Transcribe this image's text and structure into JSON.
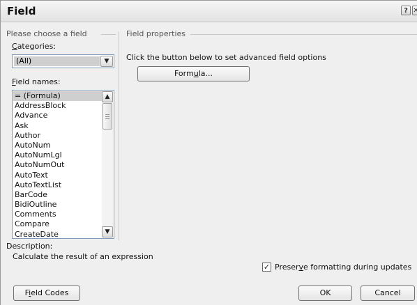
{
  "window": {
    "title": "Field",
    "help_label": "?",
    "close_label": "✕"
  },
  "left_group": {
    "heading": "Please choose a field",
    "categories_label_accel": "C",
    "categories_label_rest": "ategories:",
    "categories_value": "(All)",
    "field_names_label_accel": "F",
    "field_names_label_rest": "ield names:",
    "field_names": [
      "= (Formula)",
      "AddressBlock",
      "Advance",
      "Ask",
      "Author",
      "AutoNum",
      "AutoNumLgl",
      "AutoNumOut",
      "AutoText",
      "AutoTextList",
      "BarCode",
      "BidiOutline",
      "Comments",
      "Compare",
      "CreateDate"
    ],
    "selected_index": 0,
    "description_label": "Description:",
    "description_text": "Calculate the result of an expression"
  },
  "right_group": {
    "heading": "Field properties",
    "instruction": "Click the button below to set advanced field options",
    "formula_button_pre": "Form",
    "formula_button_accel": "u",
    "formula_button_post": "la..."
  },
  "options": {
    "preserve_pre": "Preser",
    "preserve_accel": "v",
    "preserve_post": "e formatting during updates",
    "preserve_checked": true
  },
  "footer": {
    "field_codes_pre": "F",
    "field_codes_accel": "i",
    "field_codes_post": "eld Codes",
    "ok_label": "OK",
    "cancel_label": "Cancel"
  },
  "icons": {
    "dropdown": "chevron-down-icon",
    "scroll_up": "arrow-up-icon",
    "scroll_down": "arrow-down-icon",
    "check": "checkmark-icon"
  }
}
